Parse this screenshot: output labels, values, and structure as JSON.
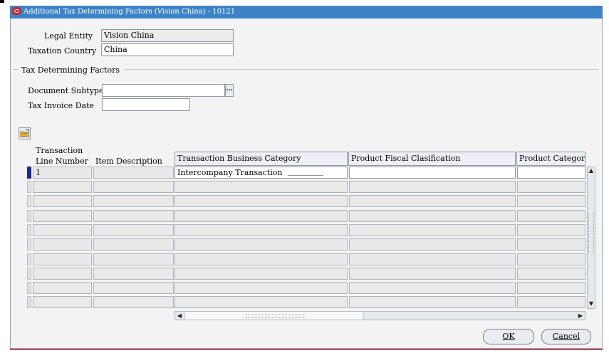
{
  "window": {
    "title": "Additional Tax Determining Factors (Vision China) - 10121"
  },
  "header": {
    "legal_entity_label": "Legal Entity",
    "legal_entity_value": "Vision China",
    "taxation_country_label": "Taxation Country",
    "taxation_country_value": "China"
  },
  "tax_factors": {
    "group_title": "Tax Determining Factors",
    "document_subtype_label": "Document Subtype",
    "document_subtype_value": "",
    "lov_button_glyph": "…",
    "tax_invoice_date_label": "Tax Invoice Date",
    "tax_invoice_date_value": ""
  },
  "table": {
    "columns": [
      "Transaction Line Number",
      "Item Description",
      "Transaction Business Category",
      "Product Fiscal Clasification",
      "Product Category"
    ],
    "col0_line1": "Transaction",
    "col0_line2": "Line Number",
    "rows": [
      {
        "line_number": "1",
        "item_description": "",
        "business_category": "Intercompany Transaction",
        "fiscal_classification": "",
        "product_category": ""
      }
    ],
    "empty_row_count": 9
  },
  "scroll": {
    "up_glyph": "▲",
    "down_glyph": "▼",
    "left_glyph": "◀",
    "right_glyph": "▶"
  },
  "footer": {
    "ok_label": "OK",
    "cancel_label": "Cancel"
  },
  "colors": {
    "titlebar": "#3d83c7",
    "current_row_indicator": "#1a2b8c"
  }
}
